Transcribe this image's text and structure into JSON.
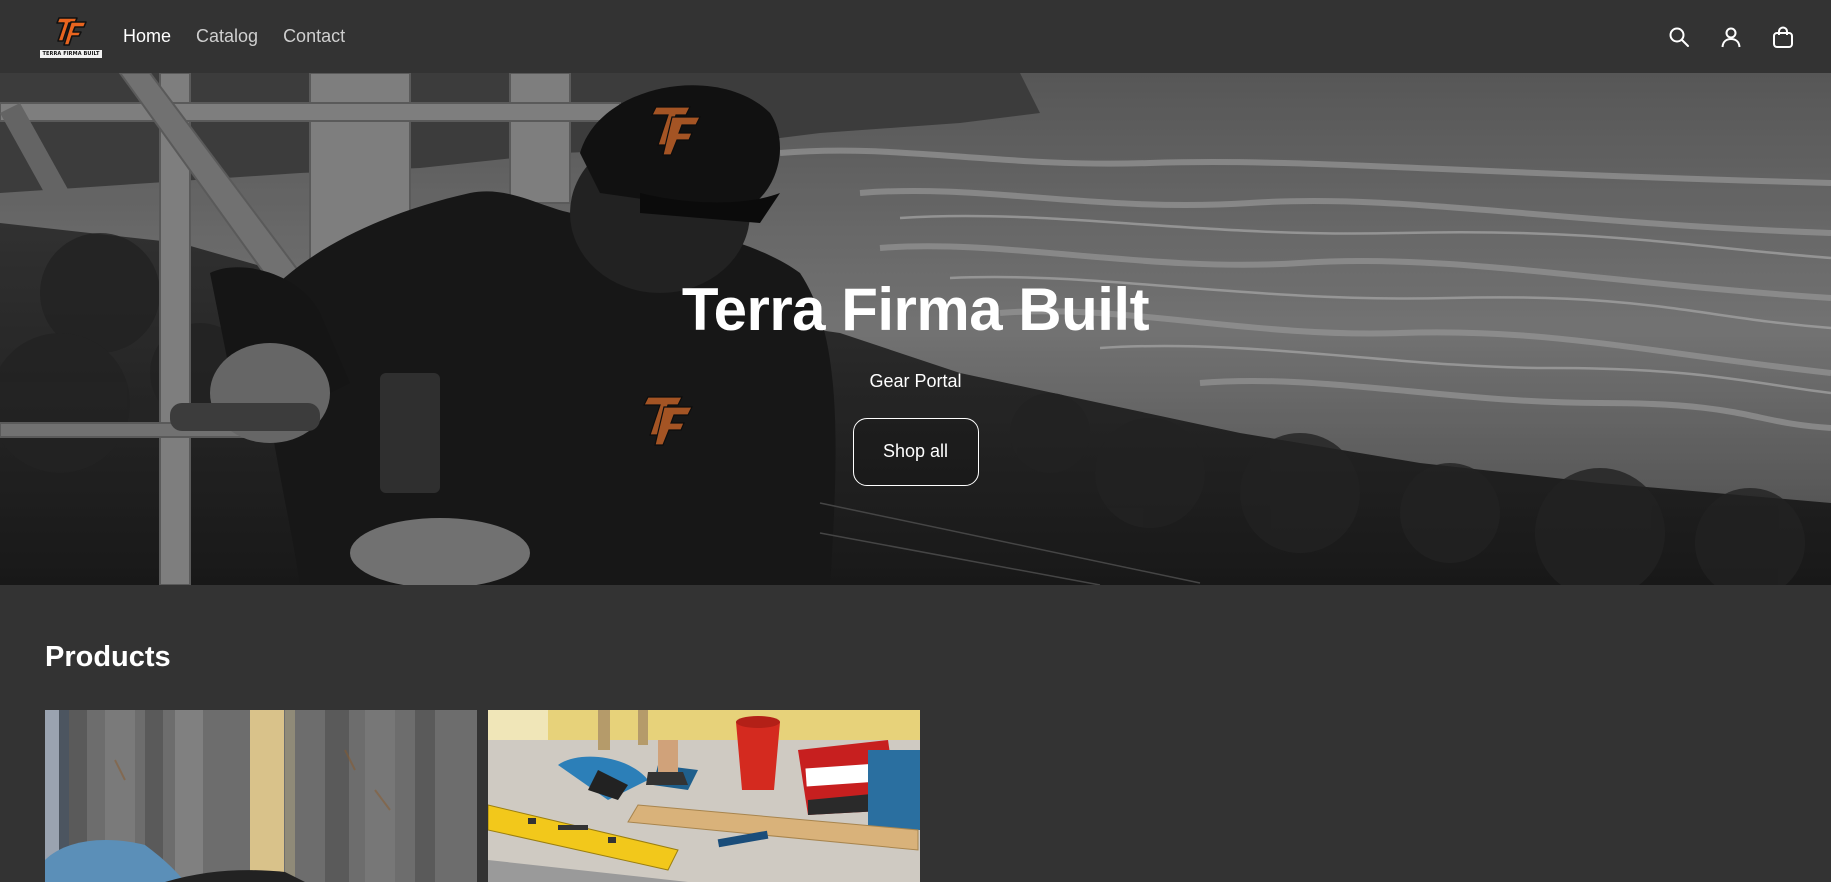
{
  "brand": {
    "logo_text": "TERRA FIRMA BUILT",
    "accent_color": "#e8641f"
  },
  "nav": {
    "items": [
      {
        "label": "Home",
        "active": true
      },
      {
        "label": "Catalog",
        "active": false
      },
      {
        "label": "Contact",
        "active": false
      }
    ]
  },
  "header_icons": [
    "search-icon",
    "account-icon",
    "cart-icon"
  ],
  "hero": {
    "title": "Terra Firma Built",
    "subtitle": "Gear Portal",
    "button_label": "Shop all"
  },
  "products": {
    "heading": "Products",
    "items": [
      {
        "image": "product-image-1"
      },
      {
        "image": "product-image-2"
      }
    ]
  },
  "colors": {
    "background": "#333333",
    "text": "#ffffff",
    "nav_inactive": "#cfcfcf"
  }
}
